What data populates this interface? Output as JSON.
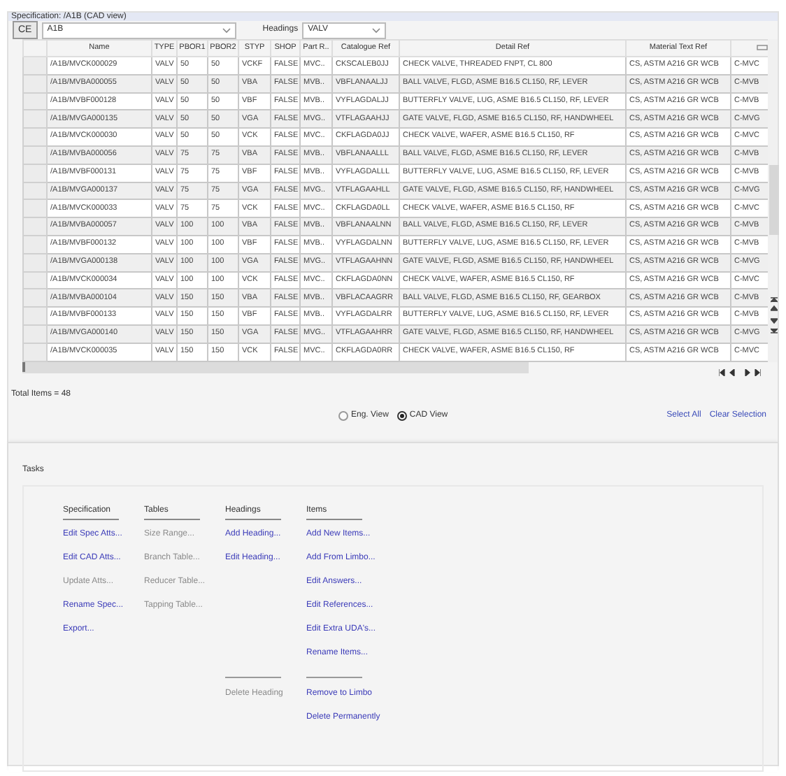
{
  "window": {
    "title": "Specification: /A1B (CAD view)"
  },
  "toolbar": {
    "ce_button": "CE",
    "spec_combo": "A1B",
    "headings_label": "Headings",
    "headings_combo": "VALV"
  },
  "table": {
    "columns": [
      "Name",
      "TYPE",
      "PBOR1",
      "PBOR2",
      "STYP",
      "SHOP",
      "Part R..",
      "Catalogue Ref",
      "Detail Ref",
      "Material Text Ref"
    ],
    "rows": [
      {
        "cells": [
          "/A1B/MVCK000029",
          "VALV",
          "50",
          "50",
          "VCKF",
          "FALSE",
          "MVC..",
          "CKSCALEB0JJ",
          "CHECK VALVE, THREADED FNPT, CL 800",
          "CS, ASTM A216 GR WCB",
          "C-MVC"
        ]
      },
      {
        "cells": [
          "/A1B/MVBA000055",
          "VALV",
          "50",
          "50",
          "VBA",
          "FALSE",
          "MVB..",
          "VBFLANAALJJ",
          "BALL VALVE, FLGD, ASME B16.5 CL150, RF, LEVER",
          "CS, ASTM A216 GR WCB",
          "C-MVB"
        ]
      },
      {
        "cells": [
          "/A1B/MVBF000128",
          "VALV",
          "50",
          "50",
          "VBF",
          "FALSE",
          "MVB..",
          "VYFLAGDALJJ",
          "BUTTERFLY VALVE, LUG, ASME B16.5 CL150, RF, LEVER",
          "CS, ASTM A216 GR WCB",
          "C-MVB"
        ]
      },
      {
        "cells": [
          "/A1B/MVGA000135",
          "VALV",
          "50",
          "50",
          "VGA",
          "FALSE",
          "MVG..",
          "VTFLAGAAHJJ",
          "GATE VALVE, FLGD, ASME B16.5 CL150, RF, HANDWHEEL",
          "CS, ASTM A216 GR WCB",
          "C-MVG"
        ]
      },
      {
        "cells": [
          "/A1B/MVCK000030",
          "VALV",
          "50",
          "50",
          "VCK",
          "FALSE",
          "MVC..",
          "CKFLAGDA0JJ",
          "CHECK VALVE, WAFER, ASME B16.5 CL150, RF",
          "CS, ASTM A216 GR WCB",
          "C-MVC"
        ]
      },
      {
        "cells": [
          "/A1B/MVBA000056",
          "VALV",
          "75",
          "75",
          "VBA",
          "FALSE",
          "MVB..",
          "VBFLANAALLL",
          "BALL VALVE, FLGD, ASME B16.5 CL150, RF, LEVER",
          "CS, ASTM A216 GR WCB",
          "C-MVB"
        ]
      },
      {
        "cells": [
          "/A1B/MVBF000131",
          "VALV",
          "75",
          "75",
          "VBF",
          "FALSE",
          "MVB..",
          "VYFLAGDALLL",
          "BUTTERFLY VALVE, LUG, ASME B16.5 CL150, RF, LEVER",
          "CS, ASTM A216 GR WCB",
          "C-MVB"
        ]
      },
      {
        "cells": [
          "/A1B/MVGA000137",
          "VALV",
          "75",
          "75",
          "VGA",
          "FALSE",
          "MVG..",
          "VTFLAGAAHLL",
          "GATE VALVE, FLGD, ASME B16.5 CL150, RF, HANDWHEEL",
          "CS, ASTM A216 GR WCB",
          "C-MVG"
        ]
      },
      {
        "cells": [
          "/A1B/MVCK000033",
          "VALV",
          "75",
          "75",
          "VCK",
          "FALSE",
          "MVC..",
          "CKFLAGDA0LL",
          "CHECK VALVE, WAFER, ASME B16.5 CL150, RF",
          "CS, ASTM A216 GR WCB",
          "C-MVC"
        ]
      },
      {
        "cells": [
          "/A1B/MVBA000057",
          "VALV",
          "100",
          "100",
          "VBA",
          "FALSE",
          "MVB..",
          "VBFLANAALNN",
          "BALL VALVE, FLGD, ASME B16.5 CL150, RF, LEVER",
          "CS, ASTM A216 GR WCB",
          "C-MVB"
        ]
      },
      {
        "cells": [
          "/A1B/MVBF000132",
          "VALV",
          "100",
          "100",
          "VBF",
          "FALSE",
          "MVB..",
          "VYFLAGDALNN",
          "BUTTERFLY VALVE, LUG, ASME B16.5 CL150, RF, LEVER",
          "CS, ASTM A216 GR WCB",
          "C-MVB"
        ]
      },
      {
        "cells": [
          "/A1B/MVGA000138",
          "VALV",
          "100",
          "100",
          "VGA",
          "FALSE",
          "MVG..",
          "VTFLAGAAHNN",
          "GATE VALVE, FLGD, ASME B16.5 CL150, RF, HANDWHEEL",
          "CS, ASTM A216 GR WCB",
          "C-MVG"
        ]
      },
      {
        "cells": [
          "/A1B/MVCK000034",
          "VALV",
          "100",
          "100",
          "VCK",
          "FALSE",
          "MVC..",
          "CKFLAGDA0NN",
          "CHECK VALVE, WAFER, ASME B16.5 CL150, RF",
          "CS, ASTM A216 GR WCB",
          "C-MVC"
        ]
      },
      {
        "cells": [
          "/A1B/MVBA000104",
          "VALV",
          "150",
          "150",
          "VBA",
          "FALSE",
          "MVB..",
          "VBFLACAAGRR",
          "BALL VALVE, FLGD, ASME B16.5 CL150, RF, GEARBOX",
          "CS, ASTM A216 GR WCB",
          "C-MVB"
        ]
      },
      {
        "cells": [
          "/A1B/MVBF000133",
          "VALV",
          "150",
          "150",
          "VBF",
          "FALSE",
          "MVB..",
          "VYFLAGDALRR",
          "BUTTERFLY VALVE, LUG, ASME B16.5 CL150, RF, LEVER",
          "CS, ASTM A216 GR WCB",
          "C-MVB"
        ]
      },
      {
        "cells": [
          "/A1B/MVGA000140",
          "VALV",
          "150",
          "150",
          "VGA",
          "FALSE",
          "MVG..",
          "VTFLAGAAHRR",
          "GATE VALVE, FLGD, ASME B16.5 CL150, RF, HANDWHEEL",
          "CS, ASTM A216 GR WCB",
          "C-MVG"
        ]
      },
      {
        "cells": [
          "/A1B/MVCK000035",
          "VALV",
          "150",
          "150",
          "VCK",
          "FALSE",
          "MVC..",
          "CKFLAGDA0RR",
          "CHECK VALVE, WAFER, ASME B16.5 CL150, RF",
          "CS, ASTM A216 GR WCB",
          "C-MVC"
        ]
      }
    ]
  },
  "total_items": "Total Items = 48",
  "views": [
    {
      "label": "Eng. View",
      "selected": false
    },
    {
      "label": "CAD View",
      "selected": true
    }
  ],
  "selection_links": [
    "Select All",
    "Clear Selection"
  ],
  "tasks": {
    "title": "Tasks",
    "columns": [
      {
        "heading": "Specification",
        "links": [
          {
            "label": "Edit Spec Atts...",
            "disabled": false
          },
          {
            "label": "Edit CAD Atts...",
            "disabled": false
          },
          {
            "label": "Update Atts...",
            "disabled": true
          },
          {
            "label": "Rename Spec...",
            "disabled": false
          },
          {
            "label": "Export...",
            "disabled": false
          }
        ]
      },
      {
        "heading": "Tables",
        "links": [
          {
            "label": "Size Range...",
            "disabled": true
          },
          {
            "label": "Branch Table...",
            "disabled": true
          },
          {
            "label": "Reducer Table...",
            "disabled": true
          },
          {
            "label": "Tapping Table...",
            "disabled": true
          }
        ]
      },
      {
        "heading": "Headings",
        "links": [
          {
            "label": "Add Heading...",
            "disabled": false
          },
          {
            "label": "Edit Heading...",
            "disabled": false
          }
        ],
        "lower_links": [
          {
            "label": "Delete Heading",
            "disabled": true
          }
        ]
      },
      {
        "heading": "Items",
        "links": [
          {
            "label": "Add New Items...",
            "disabled": false
          },
          {
            "label": "Add From Limbo...",
            "disabled": false
          },
          {
            "label": "Edit Answers...",
            "disabled": false
          },
          {
            "label": "Edit References...",
            "disabled": false
          },
          {
            "label": "Edit Extra UDA's...",
            "disabled": false
          },
          {
            "label": "Rename Items...",
            "disabled": false
          }
        ],
        "lower_links": [
          {
            "label": "Remove to Limbo",
            "disabled": false
          },
          {
            "label": "Delete Permanently",
            "disabled": false
          }
        ]
      }
    ]
  }
}
